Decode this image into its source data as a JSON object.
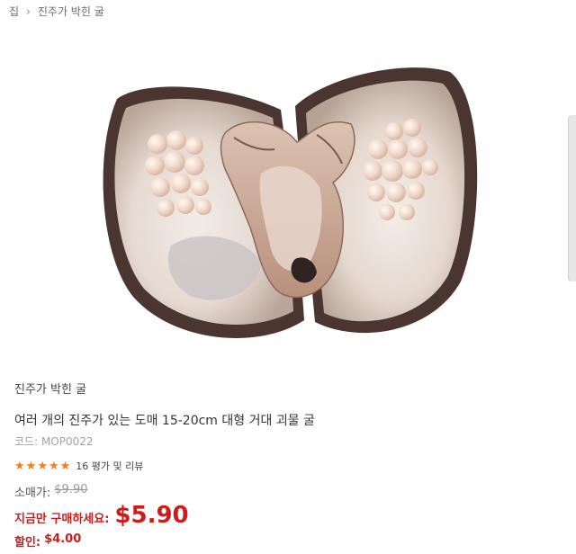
{
  "breadcrumb": {
    "home": "집",
    "separator": "›",
    "current": "진주가 박힌 굴"
  },
  "product": {
    "image_icon": "pearl-oyster-photo",
    "category": "진주가 박힌 굴",
    "title": "여러 개의 진주가 있는 도매 15-20cm 대형 거대 괴물 굴",
    "code_label": "코드:",
    "code": "MOP0022",
    "rating": {
      "stars": 5,
      "reviews_text": "16 평가 및 리뷰"
    },
    "retail_label": "소매가:",
    "retail_price": "$9.90",
    "buy_label": "지금만 구매하세요:",
    "buy_price": "$5.90",
    "discount_label": "할인:",
    "discount_amount": "$4.00"
  },
  "colors": {
    "accent_red": "#d01b1b",
    "star_orange": "#f47b20"
  }
}
